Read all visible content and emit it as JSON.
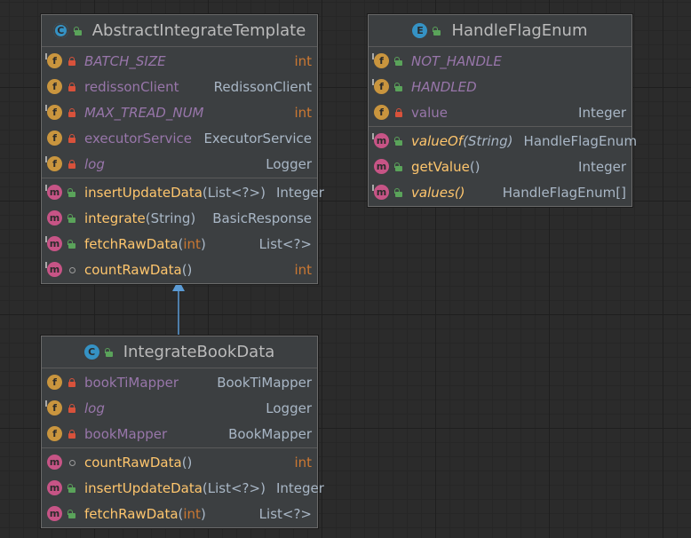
{
  "nodes": {
    "abstract_template": {
      "title": "AbstractIntegrateTemplate",
      "fields": [
        {
          "name": "BATCH_SIZE",
          "type": "int"
        },
        {
          "name": "redissonClient",
          "type": "RedissonClient"
        },
        {
          "name": "MAX_TREAD_NUM",
          "type": "int"
        },
        {
          "name": "executorService",
          "type": "ExecutorService"
        },
        {
          "name": "log",
          "type": "Logger"
        }
      ],
      "methods": [
        {
          "name": "insertUpdateData",
          "params": "(List<?>)",
          "type": "Integer"
        },
        {
          "name": "integrate",
          "params": "(String)",
          "type": "BasicResponse"
        },
        {
          "name": "fetchRawData",
          "params_open": "(",
          "params_kw": "int",
          "params_close": ")",
          "type": "List<?>"
        },
        {
          "name": "countRawData",
          "params": "()",
          "type": "int"
        }
      ]
    },
    "handle_flag_enum": {
      "title": "HandleFlagEnum",
      "fields": [
        {
          "name": "NOT_HANDLE",
          "type": ""
        },
        {
          "name": "HANDLED",
          "type": ""
        },
        {
          "name": "value",
          "type": "Integer"
        }
      ],
      "methods": [
        {
          "name": "valueOf",
          "params": "(String)",
          "type": "HandleFlagEnum"
        },
        {
          "name": "getValue",
          "params": "()",
          "type": "Integer"
        },
        {
          "name": "values",
          "params": "()",
          "type": "HandleFlagEnum[]"
        }
      ]
    },
    "integrate_book_data": {
      "title": "IntegrateBookData",
      "fields": [
        {
          "name": "bookTiMapper",
          "type": "BookTiMapper"
        },
        {
          "name": "log",
          "type": "Logger"
        },
        {
          "name": "bookMapper",
          "type": "BookMapper"
        }
      ],
      "methods": [
        {
          "name": "countRawData",
          "params": "()",
          "type": "int"
        },
        {
          "name": "insertUpdateData",
          "params": "(List<?>)",
          "type": "Integer"
        },
        {
          "name": "fetchRawData",
          "params_open": "(",
          "params_kw": "int",
          "params_close": ")",
          "type": "List<?>"
        }
      ]
    }
  },
  "icons": {
    "abstract_class": "abstract-class-icon",
    "class": "class-icon",
    "enum": "enum-icon",
    "field": "field-icon",
    "method": "method-icon"
  },
  "colors": {
    "background": "#2b2b2b",
    "node_background": "#3c3f41",
    "field_name": "#9876aa",
    "method_name": "#ffc66d",
    "keyword": "#cc7832",
    "text": "#a9b7c6",
    "inheritance_arrow": "#5b9bd5"
  }
}
